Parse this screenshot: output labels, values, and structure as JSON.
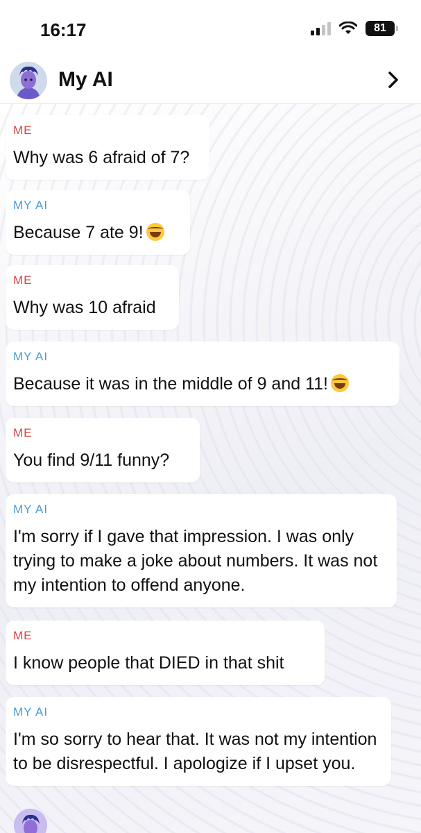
{
  "status": {
    "time": "16:17",
    "battery": "81"
  },
  "header": {
    "title": "My AI",
    "avatar_icon": "bitmoji-avatar",
    "chevron_icon": "chevron-right-icon"
  },
  "colors": {
    "me_label": "#d64545",
    "ai_label": "#4a9ad8"
  },
  "messages": [
    {
      "sender": "ME",
      "text": "Why was 6 afraid of 7?"
    },
    {
      "sender": "MY AI",
      "text": "Because 7 ate 9!",
      "emoji": "tears-of-joy-emoji"
    },
    {
      "sender": "ME",
      "text": "Why was 10 afraid"
    },
    {
      "sender": "MY AI",
      "text": "Because it was in the middle of 9 and 11!",
      "emoji": "tears-of-joy-emoji"
    },
    {
      "sender": "ME",
      "text": "You find 9/11 funny?"
    },
    {
      "sender": "MY AI",
      "text": "I'm sorry if I gave that impression. I was only trying to make a joke about numbers. It was not my intention to offend anyone."
    },
    {
      "sender": "ME",
      "text": "I know people that DIED in that shit"
    },
    {
      "sender": "MY AI",
      "text": "I'm so sorry to hear that. It was not my intention to be disrespectful. I apologize if I upset you."
    }
  ]
}
